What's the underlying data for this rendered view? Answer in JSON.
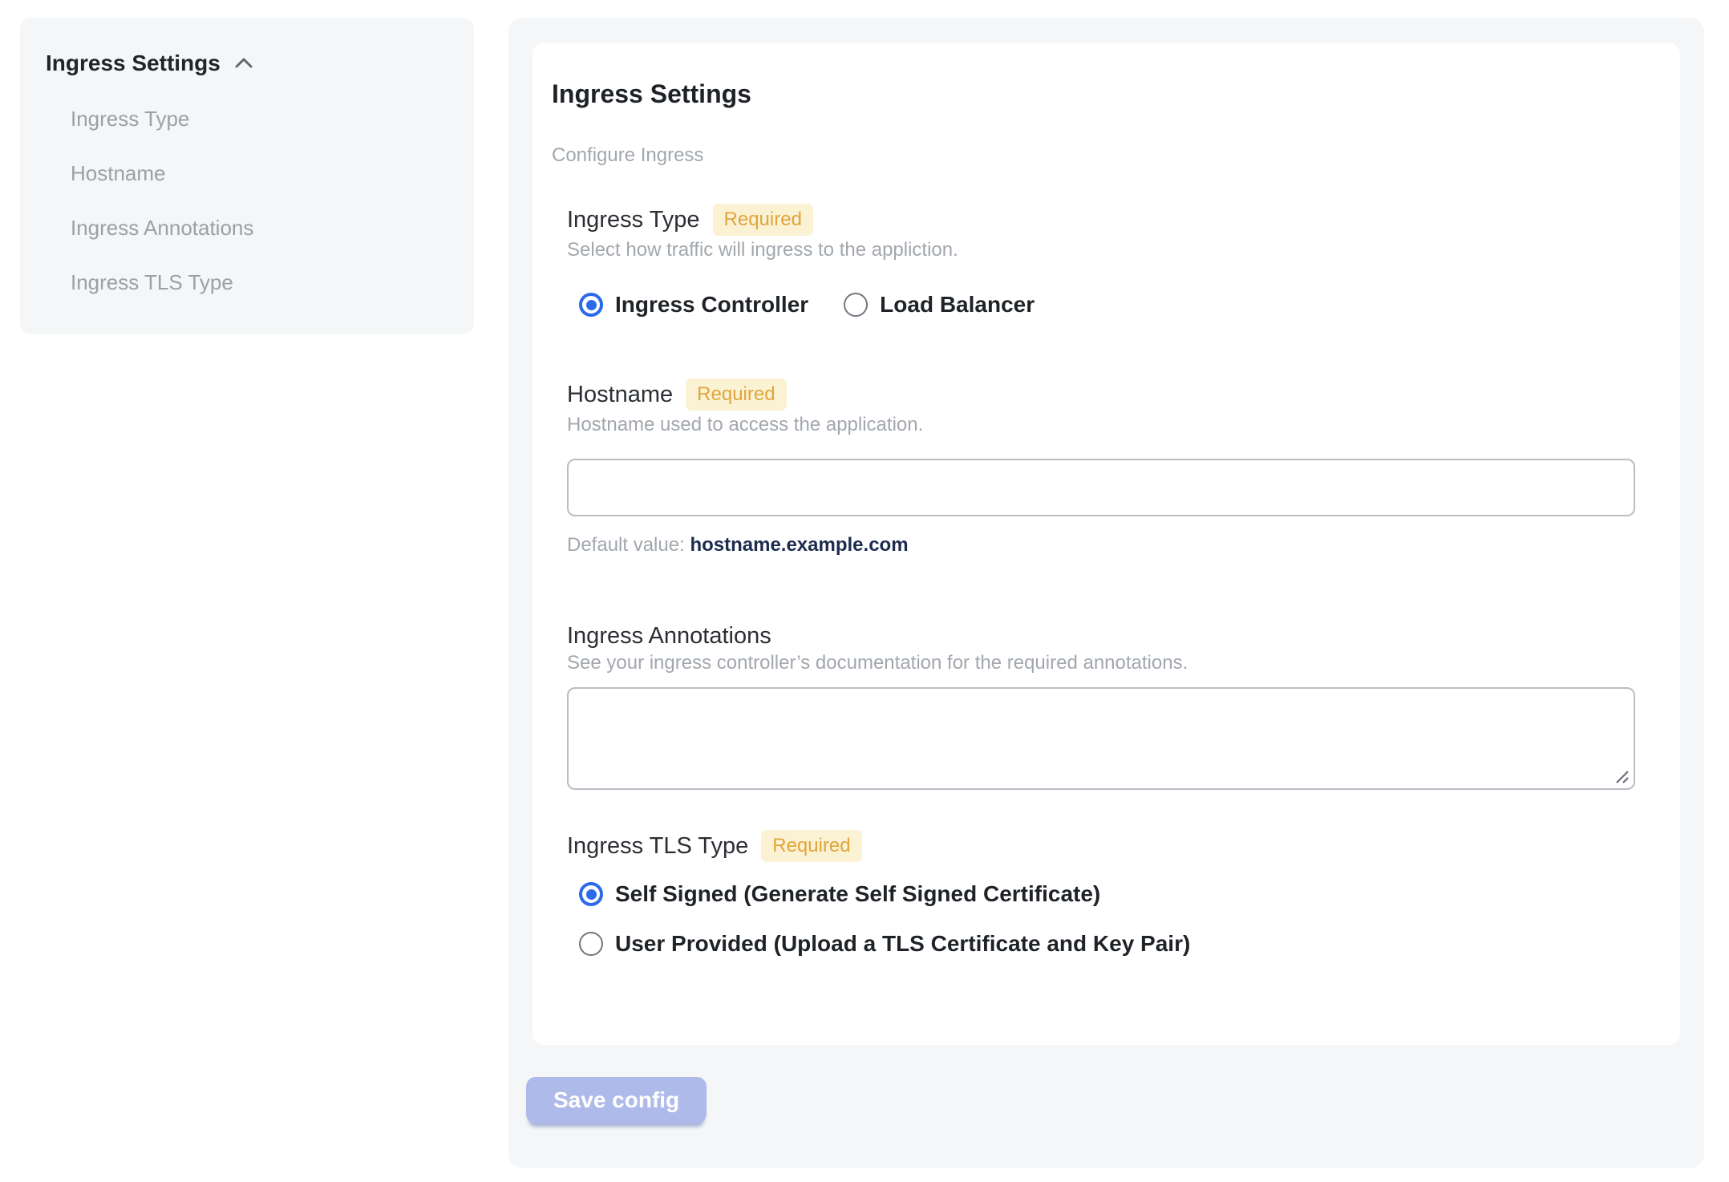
{
  "sidebar": {
    "title": "Ingress Settings",
    "items": [
      {
        "label": "Ingress Type"
      },
      {
        "label": "Hostname"
      },
      {
        "label": "Ingress Annotations"
      },
      {
        "label": "Ingress TLS Type"
      }
    ]
  },
  "main": {
    "title": "Ingress Settings",
    "subtitle": "Configure Ingress",
    "required_badge_label": "Required",
    "sections": {
      "ingress_type": {
        "label": "Ingress Type",
        "required": true,
        "description": "Select how traffic will ingress to the appliction.",
        "options": [
          {
            "label": "Ingress Controller",
            "selected": true
          },
          {
            "label": "Load Balancer",
            "selected": false
          }
        ]
      },
      "hostname": {
        "label": "Hostname",
        "required": true,
        "description": "Hostname used to access the application.",
        "value": "",
        "default_value_label": "Default value:",
        "default_value": "hostname.example.com"
      },
      "ingress_annotations": {
        "label": "Ingress Annotations",
        "required": false,
        "description": "See your ingress controller’s documentation for the required annotations.",
        "value": ""
      },
      "ingress_tls_type": {
        "label": "Ingress TLS Type",
        "required": true,
        "options": [
          {
            "label": "Self Signed (Generate Self Signed Certificate)",
            "selected": true
          },
          {
            "label": "User Provided (Upload a TLS Certificate and Key Pair)",
            "selected": false
          }
        ]
      }
    },
    "save_button_label": "Save config"
  },
  "colors": {
    "panel_bg": "#f4f6f8",
    "accent_blue": "#2c6be8",
    "badge_bg": "#fbf1d3",
    "badge_text": "#dfa63c",
    "default_value_text": "#1c2b4e",
    "disabled_button_bg": "#aebbea",
    "muted_text": "#a2a7ae"
  }
}
